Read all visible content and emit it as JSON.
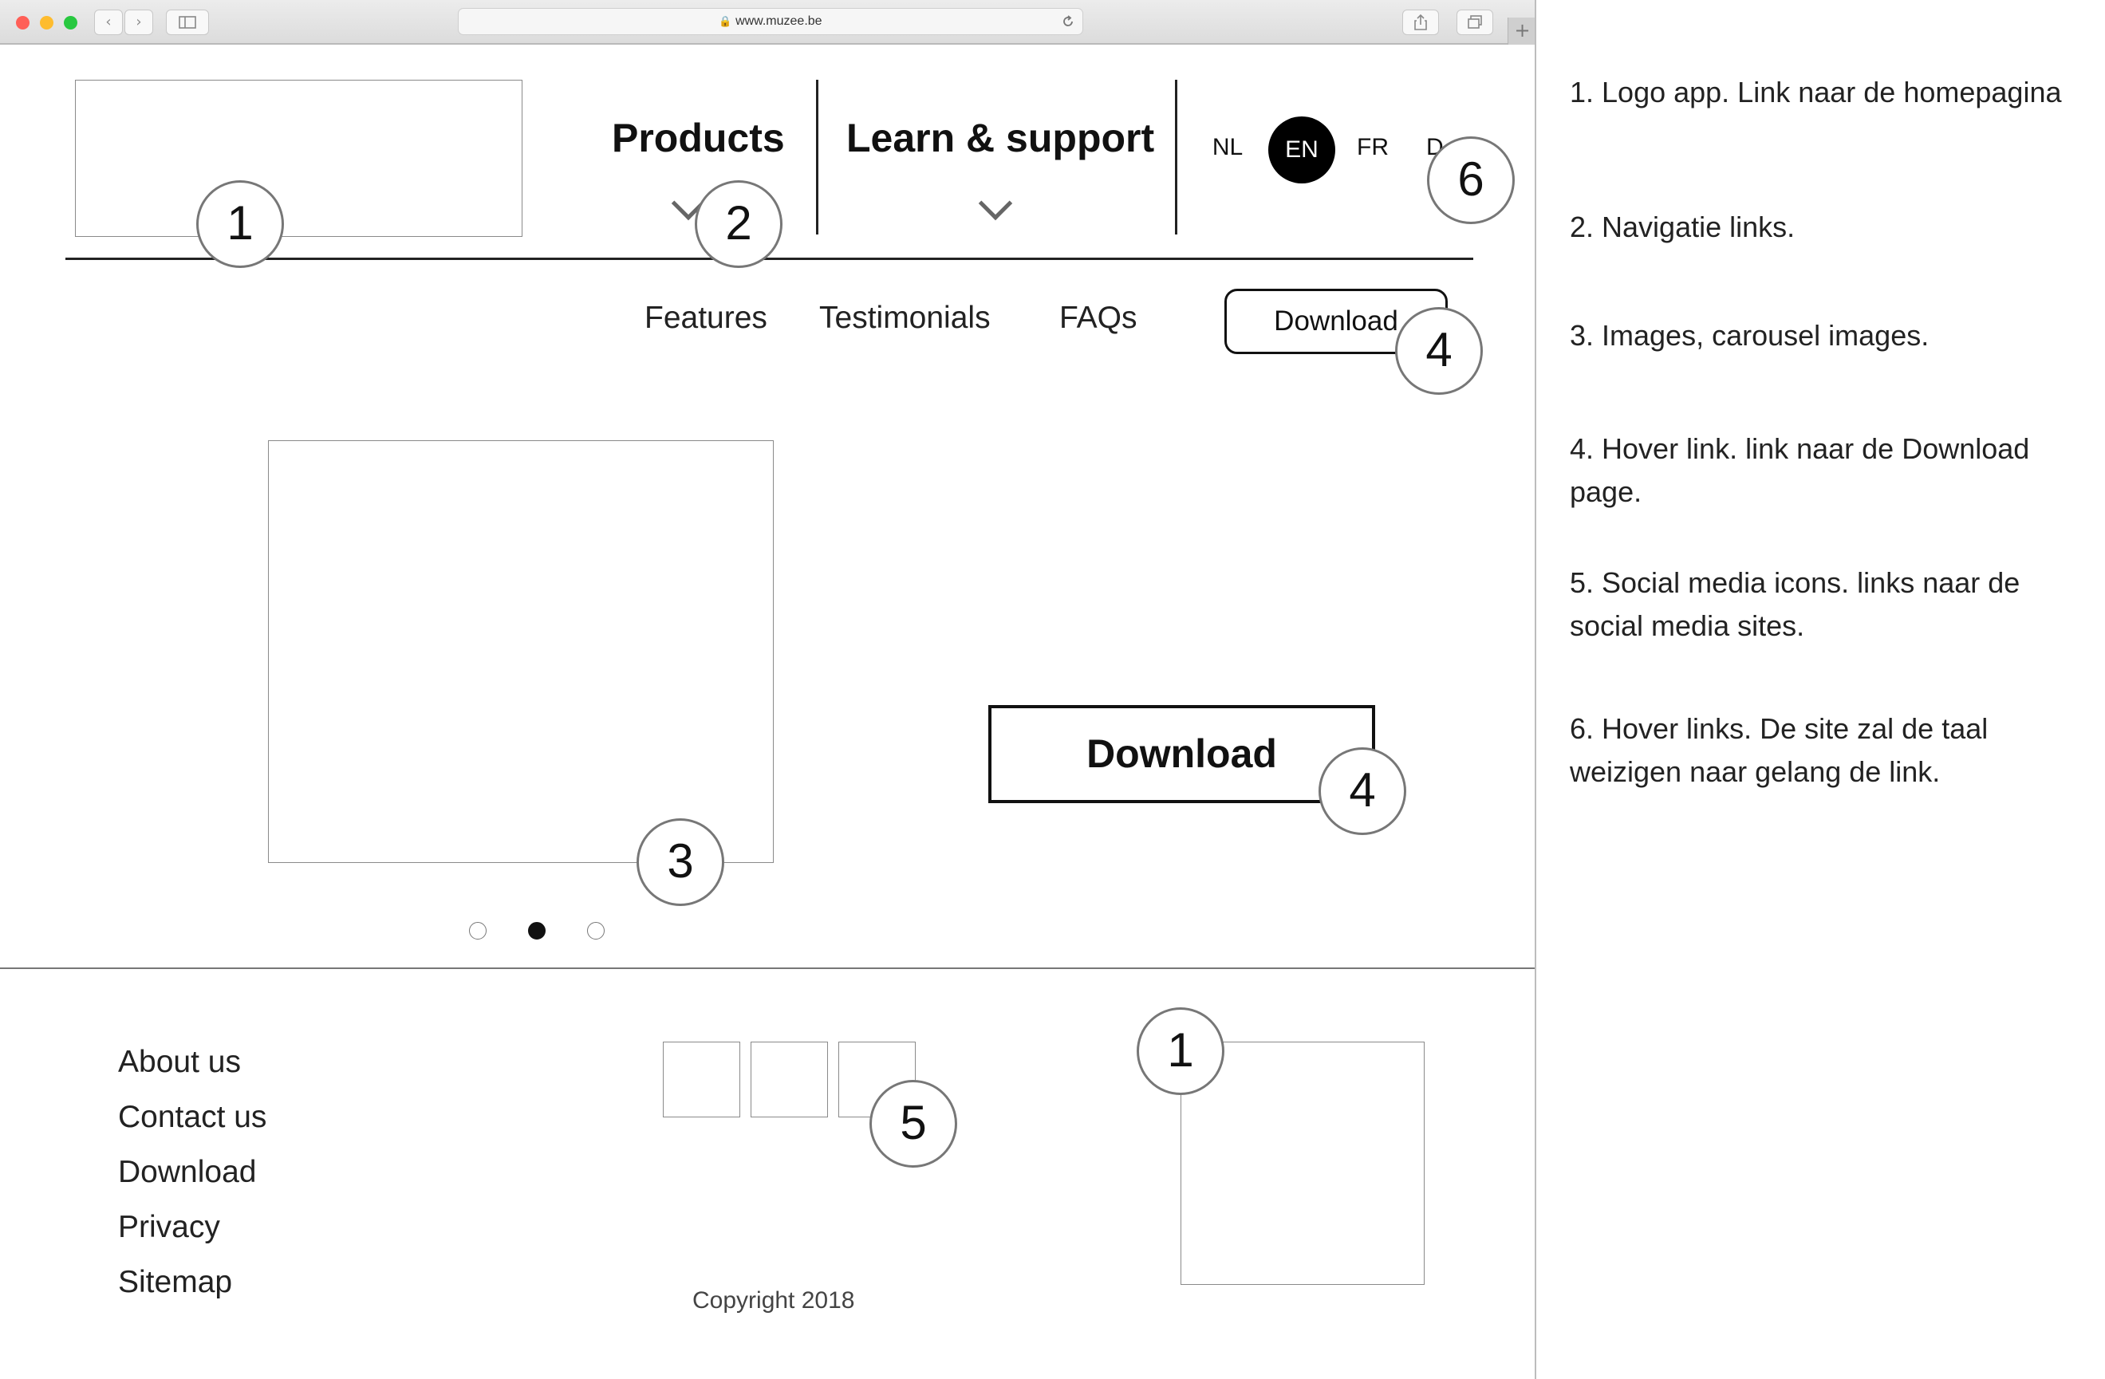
{
  "browser": {
    "url": "www.muzee.be",
    "new_tab_label": "+"
  },
  "header": {
    "nav": [
      {
        "label": "Products"
      },
      {
        "label": "Learn & support"
      }
    ],
    "languages": [
      {
        "code": "NL",
        "active": false
      },
      {
        "code": "EN",
        "active": true
      },
      {
        "code": "FR",
        "active": false
      },
      {
        "code": "D",
        "active": false
      }
    ]
  },
  "subnav": {
    "links": [
      "Features",
      "Testimonials",
      "FAQs"
    ],
    "download_label": "Download"
  },
  "hero": {
    "download_label": "Download",
    "carousel_dots": 3,
    "active_dot": 1
  },
  "footer": {
    "links": [
      "About us",
      "Contact us",
      "Download",
      "Privacy",
      "Sitemap"
    ],
    "copyright": "Copyright 2018"
  },
  "markers": {
    "logo_header": "1",
    "nav": "2",
    "carousel": "3",
    "download_subnav": "4",
    "download_hero": "4",
    "social": "5",
    "language": "6",
    "logo_footer": "1"
  },
  "annotations": [
    "1. Logo app. Link naar de homepagina",
    "2. Navigatie links.",
    "3. Images, carousel images.",
    "4. Hover link. link naar de Download page.",
    "5. Social media icons. links naar de social media sites.",
    "6. Hover links. De site zal de taal weizigen naar gelang de link."
  ],
  "colors": {
    "active_language_bg": "#000000",
    "active_dot": "#111111",
    "close_button": "#ff5f57",
    "minimize_button": "#febc2e",
    "maximize_button": "#28c840"
  }
}
